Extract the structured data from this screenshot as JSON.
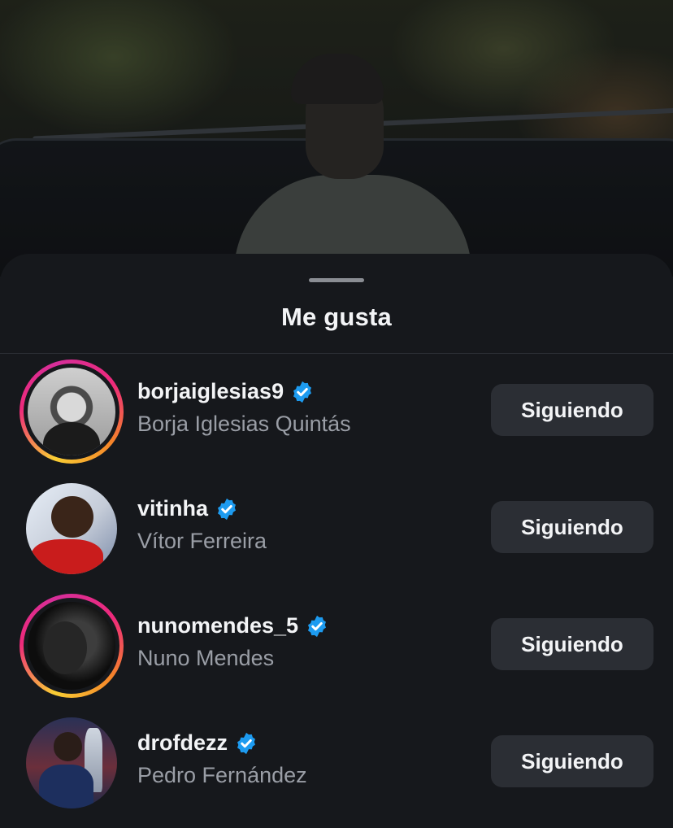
{
  "sheet": {
    "title": "Me gusta"
  },
  "likes": [
    {
      "username": "borjaiglesias9",
      "full_name": "Borja Iglesias Quintás",
      "verified": true,
      "story_ring": true,
      "button_label": "Siguiendo"
    },
    {
      "username": "vitinha",
      "full_name": "Vítor Ferreira",
      "verified": true,
      "story_ring": false,
      "button_label": "Siguiendo"
    },
    {
      "username": "nunomendes_5",
      "full_name": "Nuno Mendes",
      "verified": true,
      "story_ring": true,
      "button_label": "Siguiendo"
    },
    {
      "username": "drofdezz",
      "full_name": "Pedro Fernández",
      "verified": true,
      "story_ring": false,
      "button_label": "Siguiendo"
    }
  ],
  "colors": {
    "background": "#16181c",
    "verified_badge": "#1d9bf0",
    "button_bg": "#2b2e34",
    "secondary_text": "#9a9ea6"
  },
  "icons": {
    "verified": "verified-badge-icon"
  }
}
